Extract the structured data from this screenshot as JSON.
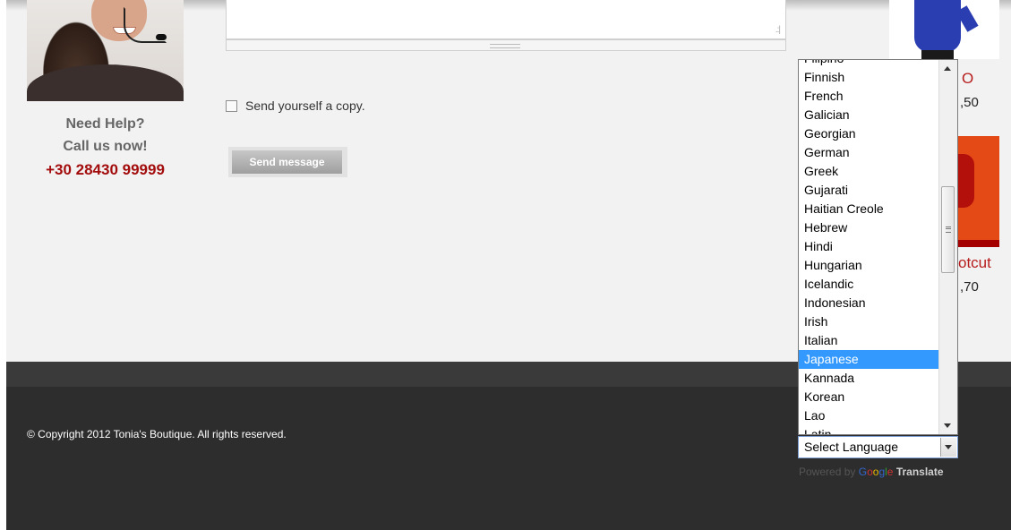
{
  "help": {
    "line1": "Need Help?",
    "line2": "Call us now!",
    "phone": "+30 28430 99999"
  },
  "form": {
    "copy_label": "Send yourself a copy.",
    "copy_checked": false,
    "send_label": "Send message"
  },
  "products": [
    {
      "name": "O",
      "price": ",50"
    },
    {
      "name": "otcut",
      "price": ",70"
    }
  ],
  "language_dropdown": {
    "options": [
      "Filipino",
      "Finnish",
      "French",
      "Galician",
      "Georgian",
      "German",
      "Greek",
      "Gujarati",
      "Haitian Creole",
      "Hebrew",
      "Hindi",
      "Hungarian",
      "Icelandic",
      "Indonesian",
      "Irish",
      "Italian",
      "Japanese",
      "Kannada",
      "Korean",
      "Lao",
      "Latin"
    ],
    "highlighted": "Japanese",
    "selected_value": "Select Language"
  },
  "powered_by": {
    "prefix": "Powered by",
    "brand_letters": [
      "G",
      "o",
      "o",
      "g",
      "l",
      "e"
    ],
    "suffix": "Translate"
  },
  "footer": {
    "copyright": "© Copyright 2012 Tonia's Boutique. All rights reserved."
  },
  "colors": {
    "accent_red": "#a30d0d",
    "highlight_blue": "#3399ff",
    "footer_bg": "#2d2d2d"
  }
}
